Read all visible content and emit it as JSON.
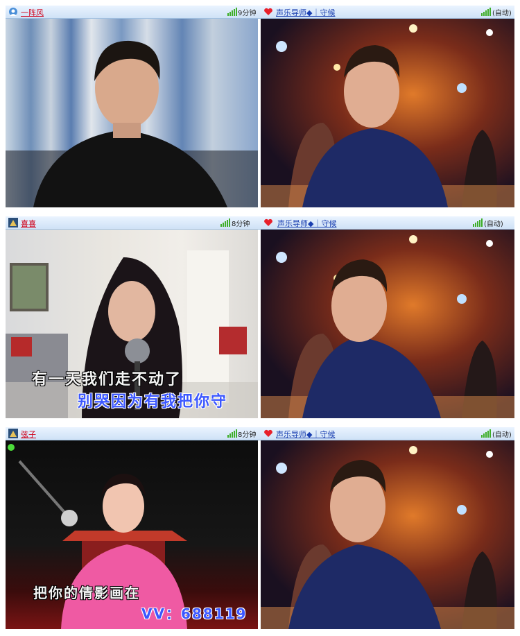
{
  "rows": [
    {
      "left": {
        "name": "一阵风",
        "timer": "9分钟"
      },
      "right": {
        "name": "声乐导师◆｜守候",
        "timer": "(自动)"
      }
    },
    {
      "left": {
        "name": "喜喜",
        "timer": "8分钟"
      },
      "right": {
        "name": "声乐导师◆｜守候",
        "timer": "(自动)"
      },
      "lyrics": {
        "line1": "有一天我们走不动了",
        "line2": "别哭因为有我把你守"
      }
    },
    {
      "left": {
        "name": "弦子",
        "timer": "8分钟"
      },
      "right": {
        "name": "声乐导师◆｜守候",
        "timer": "(自动)"
      },
      "lyrics": {
        "line1": "把你的倩影画在",
        "line2": "VV：688119"
      }
    }
  ],
  "colors": {
    "user_name": "#d0021b",
    "host_name": "#1a3fb0",
    "signal": "#3fae29",
    "header_bg": "#dbeaf8"
  }
}
